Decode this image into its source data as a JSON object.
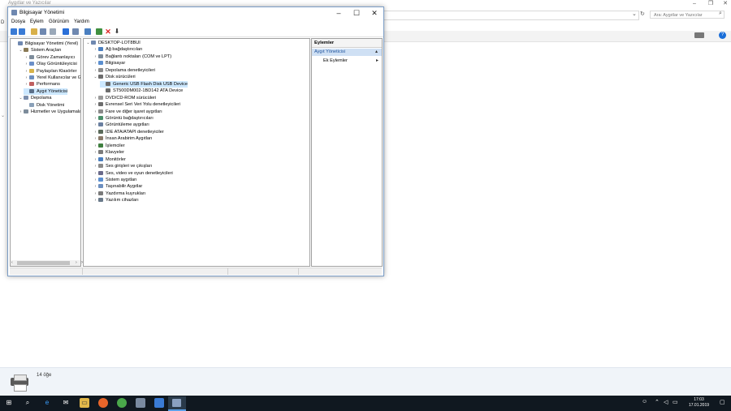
{
  "bg_window": {
    "title": "Aygıtlar ve Yazıcılar",
    "search_placeholder": "Ara: Aygıtlar ve Yazıcılar",
    "item_count": "14 öğe"
  },
  "window": {
    "title": "Bilgisayar Yönetimi",
    "menu": [
      "Dosya",
      "Eylem",
      "Görünüm",
      "Yardım"
    ]
  },
  "left_tree": [
    {
      "label": "Bilgisayar Yönetimi (Yerel)",
      "indent": 0,
      "exp": "",
      "color": "#6f88b0"
    },
    {
      "label": "Sistem Araçları",
      "indent": 1,
      "exp": "⌄",
      "color": "#8a7a55"
    },
    {
      "label": "Görev Zamanlayıcı",
      "indent": 2,
      "exp": "›",
      "color": "#7d8c9b"
    },
    {
      "label": "Olay Görüntüleyicisi",
      "indent": 2,
      "exp": "›",
      "color": "#6b8fc8"
    },
    {
      "label": "Paylaşılan Klasörler",
      "indent": 2,
      "exp": "›",
      "color": "#d7b34a"
    },
    {
      "label": "Yerel Kullanıcılar ve Gru",
      "indent": 2,
      "exp": "›",
      "color": "#6d8fbf"
    },
    {
      "label": "Performans",
      "indent": 2,
      "exp": "›",
      "color": "#c06060"
    },
    {
      "label": "Aygıt Yöneticisi",
      "indent": 2,
      "exp": "",
      "color": "#5b6f88",
      "selected": true
    },
    {
      "label": "Depolama",
      "indent": 1,
      "exp": "⌄",
      "color": "#7b8fae"
    },
    {
      "label": "Disk Yönetimi",
      "indent": 2,
      "exp": "",
      "color": "#8aa0b8"
    },
    {
      "label": "Hizmetler ve Uygulamalar",
      "indent": 1,
      "exp": "›",
      "color": "#7d8c9b"
    }
  ],
  "device_tree": [
    {
      "label": "DESKTOP-LOT8BUI",
      "indent": 0,
      "exp": "⌄",
      "color": "#6f88b0"
    },
    {
      "label": "Ağ bağdaştırıcıları",
      "indent": 1,
      "exp": "›",
      "color": "#4a7fc0"
    },
    {
      "label": "Bağlantı noktaları (COM ve LPT)",
      "indent": 1,
      "exp": "›",
      "color": "#7d8c9b"
    },
    {
      "label": "Bilgisayar",
      "indent": 1,
      "exp": "›",
      "color": "#5b8fd0"
    },
    {
      "label": "Depolama denetleyicileri",
      "indent": 1,
      "exp": "›",
      "color": "#8a8a8a"
    },
    {
      "label": "Disk sürücüleri",
      "indent": 1,
      "exp": "⌄",
      "color": "#6d6d6d"
    },
    {
      "label": "Generic USB Flash Disk USB Device",
      "indent": 2,
      "exp": "",
      "color": "#6d6d6d",
      "selected": true
    },
    {
      "label": "ST500DM002-1BD142 ATA Device",
      "indent": 2,
      "exp": "",
      "color": "#6d6d6d"
    },
    {
      "label": "DVD/CD-ROM sürücüleri",
      "indent": 1,
      "exp": "›",
      "color": "#9a9a9a"
    },
    {
      "label": "Evrensel Seri Veri Yolu denetleyicileri",
      "indent": 1,
      "exp": "›",
      "color": "#6d6d6d"
    },
    {
      "label": "Fare ve diğer işaret aygıtları",
      "indent": 1,
      "exp": "›",
      "color": "#8a8a8a"
    },
    {
      "label": "Görüntü bağdaştırıcıları",
      "indent": 1,
      "exp": "›",
      "color": "#4a8f6a"
    },
    {
      "label": "Görüntüleme aygıtları",
      "indent": 1,
      "exp": "›",
      "color": "#6a7fa0"
    },
    {
      "label": "IDE ATA/ATAPI denetleyiciler",
      "indent": 1,
      "exp": "›",
      "color": "#5a6a5a"
    },
    {
      "label": "İnsan Arabirim Aygıtları",
      "indent": 1,
      "exp": "›",
      "color": "#8a7a6a"
    },
    {
      "label": "İşlemciler",
      "indent": 1,
      "exp": "›",
      "color": "#3f7f3f"
    },
    {
      "label": "Klavyeler",
      "indent": 1,
      "exp": "›",
      "color": "#7a7a7a"
    },
    {
      "label": "Monitörler",
      "indent": 1,
      "exp": "›",
      "color": "#4a7fc0"
    },
    {
      "label": "Ses girişleri ve çıkışları",
      "indent": 1,
      "exp": "›",
      "color": "#8a8a8a"
    },
    {
      "label": "Ses, video ve oyun denetleyicileri",
      "indent": 1,
      "exp": "›",
      "color": "#6a6a8a"
    },
    {
      "label": "Sistem aygıtları",
      "indent": 1,
      "exp": "›",
      "color": "#5b8fd0"
    },
    {
      "label": "Taşınabilir Aygıtlar",
      "indent": 1,
      "exp": "›",
      "color": "#6d8fbf"
    },
    {
      "label": "Yazdırma kuyrukları",
      "indent": 1,
      "exp": "›",
      "color": "#7a7a7a"
    },
    {
      "label": "Yazılım cihazları",
      "indent": 1,
      "exp": "›",
      "color": "#6a7a8a"
    }
  ],
  "actions": {
    "header": "Eylemler",
    "section": "Aygıt Yöneticisi",
    "more": "Ek Eylemler"
  },
  "taskbar": {
    "time": "17:03",
    "date": "17.01.2019"
  },
  "colors": {
    "accent": "#0078d7",
    "selection": "#cce8ff",
    "taskbar": "#101820"
  }
}
